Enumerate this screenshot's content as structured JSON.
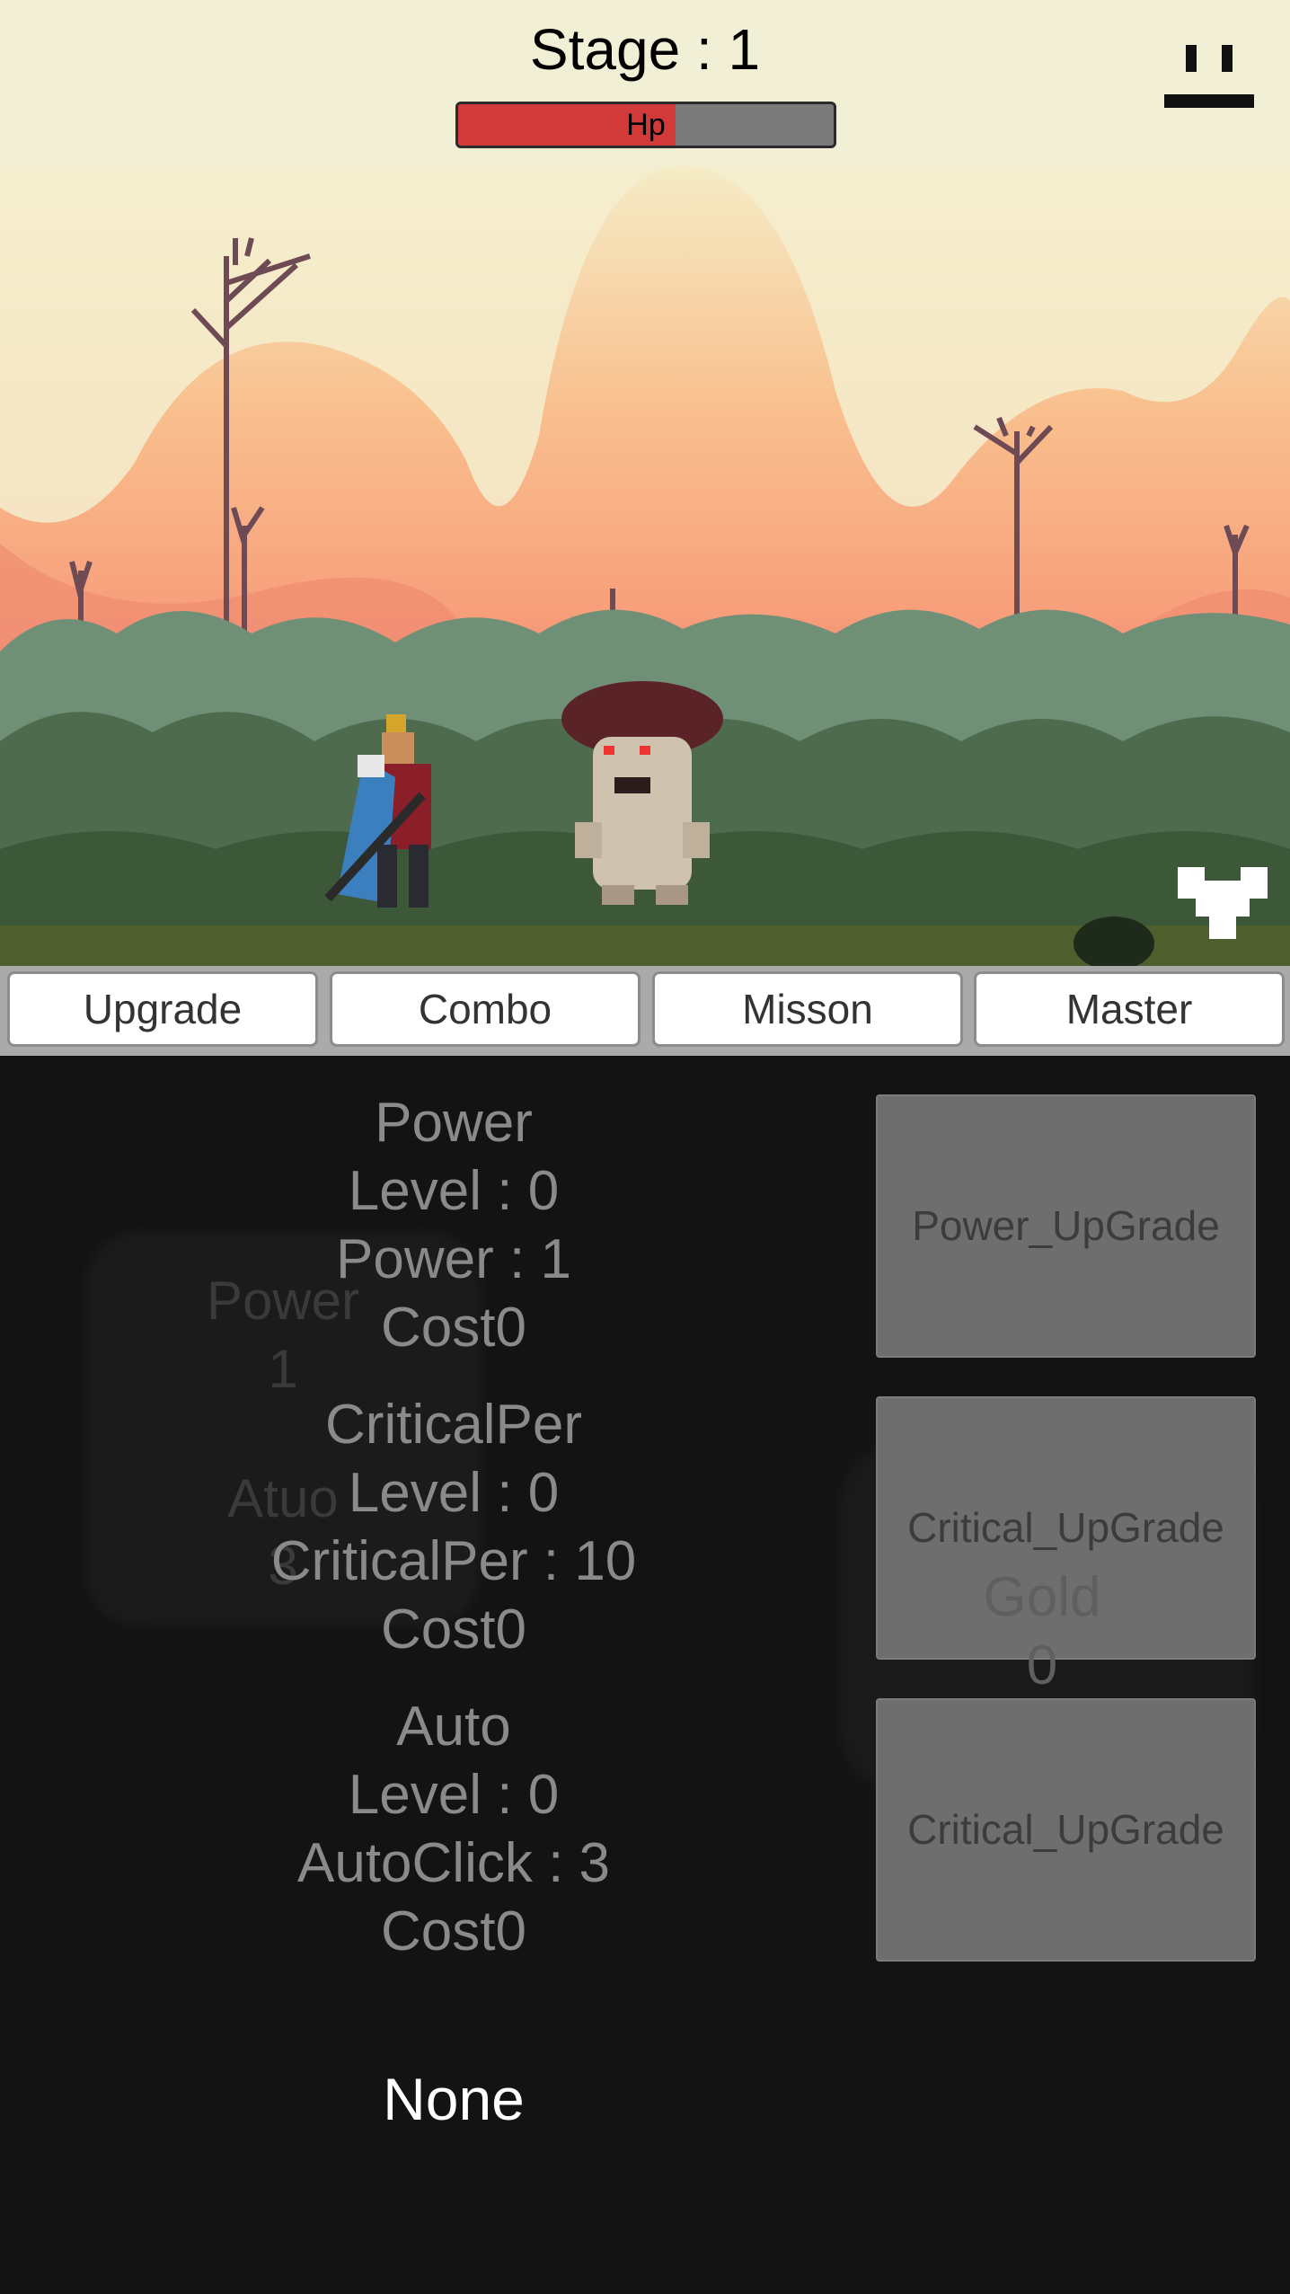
{
  "header": {
    "stage_text": "Stage : 1",
    "hp_label": "Hp",
    "hp_fraction": 0.58
  },
  "tabs": [
    "Upgrade",
    "Combo",
    "Misson",
    "Master"
  ],
  "stats": [
    {
      "title": "Power",
      "level": "Level : 0",
      "value": "Power : 1",
      "cost": "Cost0",
      "button": "Power_UpGrade"
    },
    {
      "title": "CriticalPer",
      "level": "Level : 0",
      "value": "CriticalPer : 10",
      "cost": "Cost0",
      "button": "Critical_UpGrade"
    },
    {
      "title": "Auto",
      "level": "Level : 0",
      "value": "AutoClick : 3",
      "cost": "Cost0",
      "button": "Critical_UpGrade"
    }
  ],
  "ghost": {
    "power_label": "Power",
    "power_value": "1",
    "auto_label": "Atuo",
    "auto_value": "3",
    "gold_label": "Gold",
    "gold_value": "0"
  },
  "footer_text": "None",
  "colors": {
    "hp_fill": "#d23a3a",
    "panel_bg": "#131313",
    "button_bg": "#6e6e6e"
  },
  "icons": {
    "pause": "pause-icon",
    "heart": "heart-icon"
  }
}
